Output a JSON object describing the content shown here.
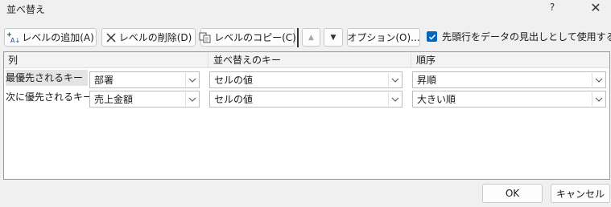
{
  "window": {
    "title": "並べ替え",
    "help_glyph": "?",
    "close_glyph": "✕"
  },
  "toolbar": {
    "add_level": "レベルの追加(A)",
    "delete_level": "レベルの削除(D)",
    "copy_level": "レベルのコピー(C)",
    "move_up_glyph": "▲",
    "move_down_glyph": "▼",
    "options": "オプション(O)...",
    "header_checkbox_label": "先頭行をデータの見出しとして使用する(H)",
    "header_checkbox_checked": true
  },
  "grid": {
    "columns": [
      "列",
      "並べ替えのキー",
      "順序"
    ],
    "rows": [
      {
        "label": "最優先されるキー",
        "column": "部署",
        "sort_on": "セルの値",
        "order": "昇順",
        "selected": true
      },
      {
        "label": "次に優先されるキー",
        "column": "売上金額",
        "sort_on": "セルの値",
        "order": "大きい順",
        "selected": false
      }
    ]
  },
  "footer": {
    "ok": "OK",
    "cancel": "キャンセル"
  },
  "colors": {
    "accent": "#0067c0",
    "background": "#f0f0f0"
  },
  "icons": [
    "add-level-icon",
    "delete-level-icon",
    "copy-level-icon",
    "chevron-down-icon",
    "checkmark-icon",
    "close-icon",
    "help-icon"
  ]
}
